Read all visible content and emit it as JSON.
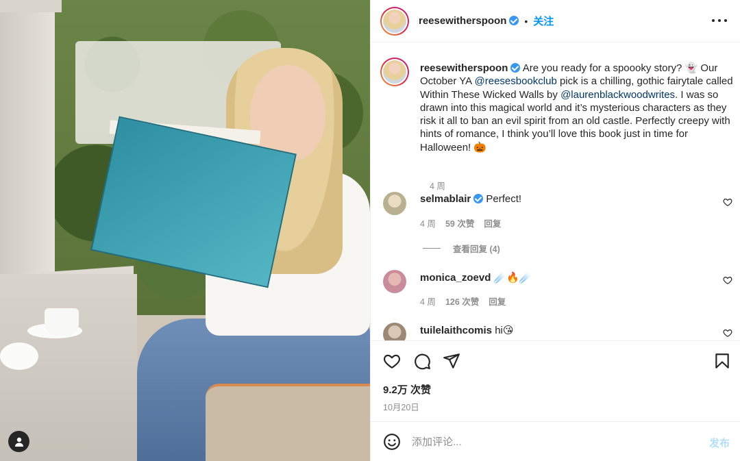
{
  "post": {
    "username": "reesewitherspoon",
    "separator": "•",
    "follow_label": "关注",
    "caption": {
      "username": "reesewitherspoon",
      "text_1": "Are you ready for a spoooky story? 👻 Our October YA ",
      "mention_1": "@reesesbookclub",
      "text_2": " pick is a chilling, gothic fairytale called Within These Wicked Walls by ",
      "mention_2": "@laurenblackwoodwrites",
      "text_3": ". I was so drawn into this magical world and it’s mysterious characters as they risk it all to ban an evil spirit from an old castle. Perfectly creepy with hints of romance, I think you’ll love this book just in time for Halloween! 🎃",
      "time": "4 周"
    },
    "comments": [
      {
        "username": "selmablair",
        "text": "Perfect!",
        "time": "4 周",
        "likes": "59 次赞",
        "reply_label": "回复",
        "avatar_color": "#c9c3a8"
      },
      {
        "username": "monica_zoevd",
        "text": "☄️🔥☄️",
        "time": "4 周",
        "likes": "126 次赞",
        "reply_label": "回复",
        "avatar_color": "#d9a7b0"
      },
      {
        "username": "tuilelaithcomis",
        "text": "hi😘",
        "avatar_color": "#b8a999"
      }
    ],
    "view_replies_label": "查看回复 (4)",
    "likes_count": "9.2万 次赞",
    "date": "10月20日",
    "comment_placeholder": "添加评论...",
    "post_button": "发布"
  },
  "colors": {
    "link_blue": "#0095f6",
    "mention": "#00376b",
    "verified": "#3897f0",
    "muted": "#8e8e8e"
  },
  "icons": [
    "verified-badge-icon",
    "more-options-icon",
    "heart-icon",
    "comment-icon",
    "share-icon",
    "bookmark-icon",
    "emoji-icon",
    "user-tag-icon"
  ]
}
